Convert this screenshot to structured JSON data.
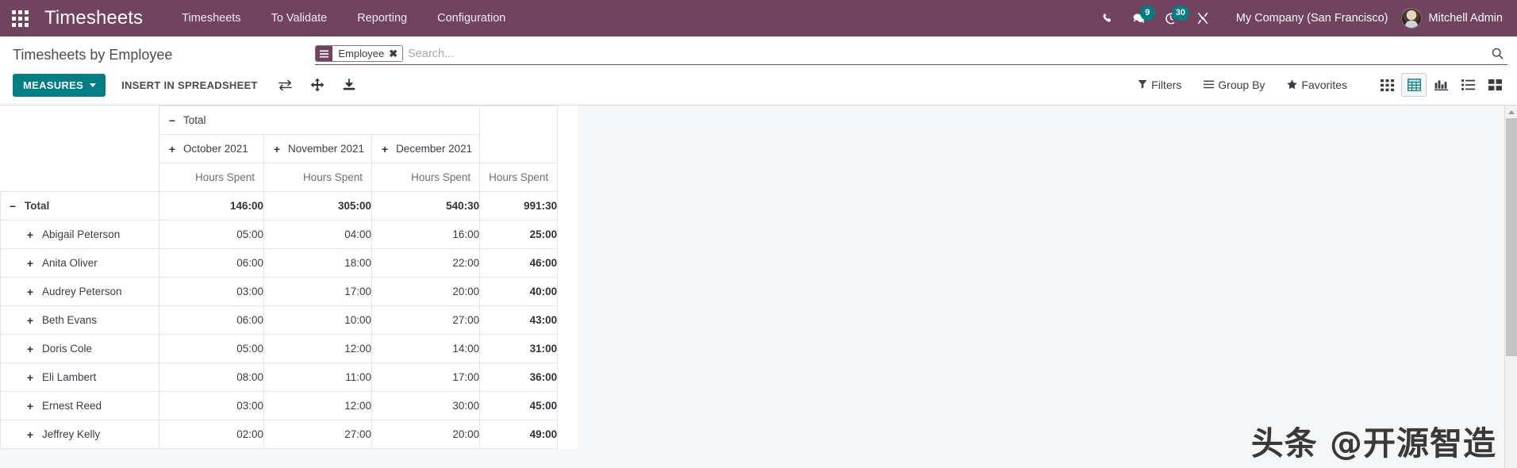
{
  "navbar": {
    "apps_icon": "apps-grid-icon",
    "brand": "Timesheets",
    "menu": [
      {
        "label": "Timesheets"
      },
      {
        "label": "To Validate"
      },
      {
        "label": "Reporting"
      },
      {
        "label": "Configuration"
      }
    ],
    "icons": {
      "phone": "phone-icon",
      "messages": "chat-bubble-icon",
      "activities": "clock-activity-icon",
      "debug": "wrench-tools-icon"
    },
    "messages_badge": "9",
    "activities_badge": "30",
    "company": "My Company (San Francisco)",
    "user": "Mitchell Admin",
    "bg_color": "#71435f",
    "badge_color": "#017e84"
  },
  "control_panel": {
    "page_title": "Timesheets by Employee",
    "search": {
      "facet_label": "Employee",
      "facet_icon": "group-by-bars-icon",
      "facet_close": "✖",
      "placeholder": "Search...",
      "value": "",
      "submit_icon": "search-icon"
    },
    "buttons": {
      "measures": "MEASURES",
      "insert_in_spreadsheet": "INSERT IN SPREADSHEET",
      "flip_axis_icon": "flip-axis-icon",
      "expand_all_icon": "expand-all-icon",
      "download_xlsx_icon": "download-icon"
    },
    "dropdowns": [
      {
        "label": "Filters",
        "icon": "filter-funnel-icon"
      },
      {
        "label": "Group By",
        "icon": "group-by-bars-icon"
      },
      {
        "label": "Favorites",
        "icon": "star-icon"
      }
    ],
    "views": [
      {
        "name": "grid-view",
        "icon": "grid-dots-icon",
        "active": false
      },
      {
        "name": "pivot-view",
        "icon": "pivot-table-icon",
        "active": true
      },
      {
        "name": "graph-view",
        "icon": "bar-chart-icon",
        "active": false
      },
      {
        "name": "list-view",
        "icon": "list-icon",
        "active": false
      },
      {
        "name": "kanban-view",
        "icon": "kanban-icon",
        "active": false
      }
    ],
    "accent_color": "#017e84"
  },
  "pivot": {
    "col_group_root": {
      "label": "Total",
      "toggle": "−"
    },
    "col_groups": [
      {
        "label": "October 2021",
        "toggle": "+"
      },
      {
        "label": "November 2021",
        "toggle": "+"
      },
      {
        "label": "December 2021",
        "toggle": "+"
      }
    ],
    "measure_label": "Hours Spent",
    "total_column_label": "Hours Spent",
    "row_total": {
      "label": "Total",
      "toggle": "−",
      "values": [
        "146:00",
        "305:00",
        "540:30"
      ],
      "total": "991:30"
    },
    "rows": [
      {
        "label": "Abigail Peterson",
        "toggle": "+",
        "values": [
          "05:00",
          "04:00",
          "16:00"
        ],
        "total": "25:00"
      },
      {
        "label": "Anita Oliver",
        "toggle": "+",
        "values": [
          "06:00",
          "18:00",
          "22:00"
        ],
        "total": "46:00"
      },
      {
        "label": "Audrey Peterson",
        "toggle": "+",
        "values": [
          "03:00",
          "17:00",
          "20:00"
        ],
        "total": "40:00"
      },
      {
        "label": "Beth Evans",
        "toggle": "+",
        "values": [
          "06:00",
          "10:00",
          "27:00"
        ],
        "total": "43:00"
      },
      {
        "label": "Doris Cole",
        "toggle": "+",
        "values": [
          "05:00",
          "12:00",
          "14:00"
        ],
        "total": "31:00"
      },
      {
        "label": "Eli Lambert",
        "toggle": "+",
        "values": [
          "08:00",
          "11:00",
          "17:00"
        ],
        "total": "36:00"
      },
      {
        "label": "Ernest Reed",
        "toggle": "+",
        "values": [
          "03:00",
          "12:00",
          "30:00"
        ],
        "total": "45:00"
      },
      {
        "label": "Jeffrey Kelly",
        "toggle": "+",
        "values": [
          "02:00",
          "27:00",
          "20:00"
        ],
        "total": "49:00"
      }
    ]
  },
  "watermark": "头条 @开源智造"
}
